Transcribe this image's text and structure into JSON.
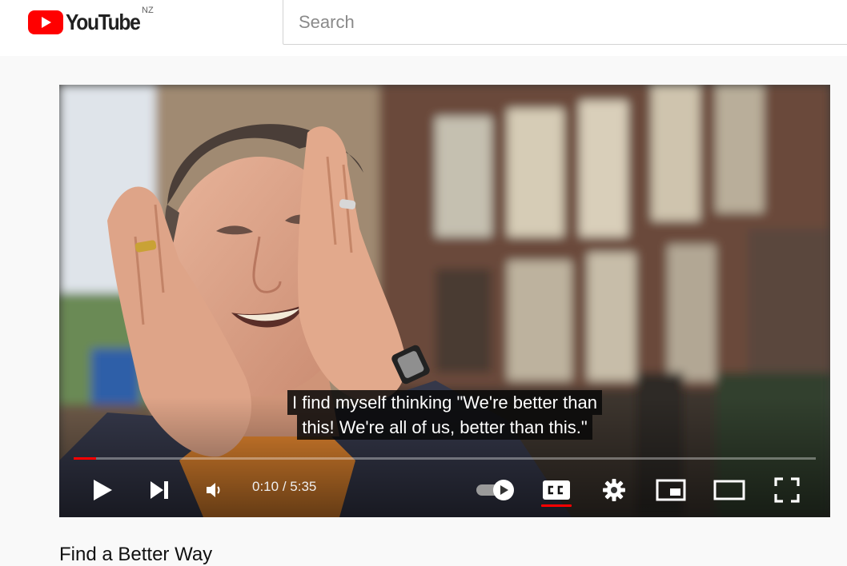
{
  "header": {
    "logo_text": "YouTube",
    "region": "NZ",
    "search_placeholder": "Search",
    "brand_red": "#ff0000"
  },
  "player": {
    "captions": [
      "I find myself thinking \"We're better than",
      "this! We're all of us, better than this.\""
    ],
    "time_current": "0:10",
    "time_total": "5:35",
    "time_display": "0:10 / 5:35",
    "progress_fraction": 0.03,
    "autoplay_on": true,
    "captions_on": true,
    "controls": [
      "play-icon",
      "next-icon",
      "volume-icon",
      "autoplay-toggle",
      "cc-icon",
      "gear-icon",
      "miniplayer-icon",
      "theater-icon",
      "fullscreen-icon"
    ]
  },
  "video": {
    "title": "Find a Better Way"
  }
}
